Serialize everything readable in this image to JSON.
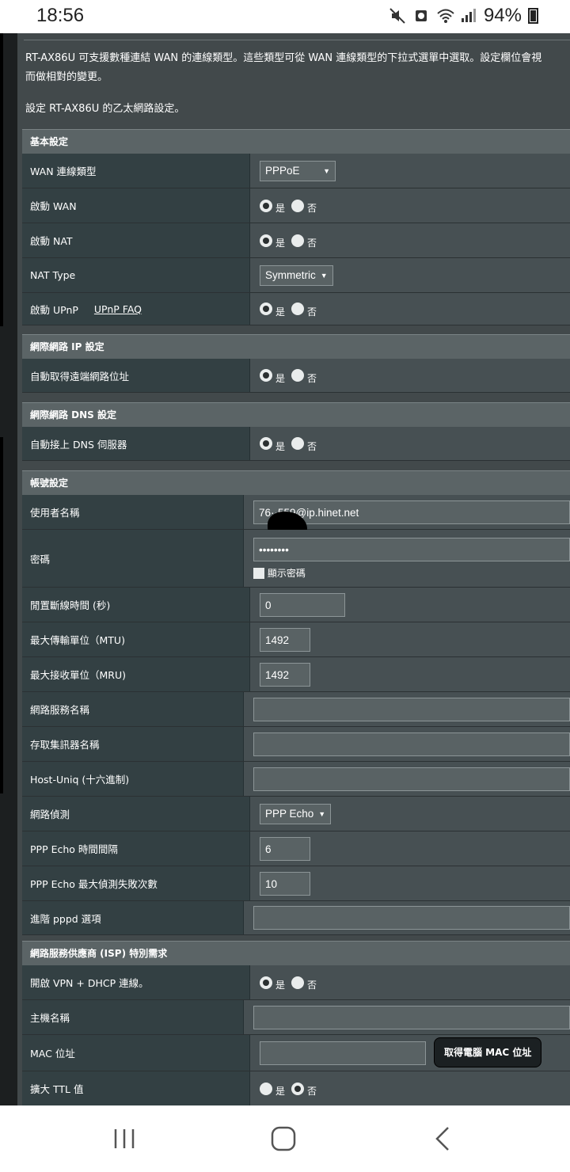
{
  "status": {
    "time": "18:56",
    "battery": "94%",
    "icons": [
      "mute-icon",
      "alarm-icon",
      "wifi-icon",
      "signal-icon",
      "battery-icon"
    ]
  },
  "intro": {
    "line1": "RT-AX86U 可支援數種連結 WAN 的連線類型。這些類型可從 WAN 連線類型的下拉式選單中選取。設定欄位會視",
    "line2": "而做相對的變更。",
    "line3": "設定 RT-AX86U 的乙太網路設定。"
  },
  "common": {
    "yes": "是",
    "no": "否"
  },
  "basic": {
    "title": "基本設定",
    "wan_type_label": "WAN 連線類型",
    "wan_type_value": "PPPoE",
    "enable_wan_label": "啟動 WAN",
    "enable_nat_label": "啟動 NAT",
    "nat_type_label": "NAT Type",
    "nat_type_value": "Symmetric",
    "upnp_label": "啟動 UPnP",
    "upnp_faq": "UPnP FAQ"
  },
  "ip": {
    "title": "網際網路 IP 設定",
    "auto_ip_label": "自動取得遠端網路位址"
  },
  "dns": {
    "title": "網際網路 DNS 設定",
    "auto_dns_label": "自動接上 DNS 伺服器"
  },
  "account": {
    "title": "帳號設定",
    "username_label": "使用者名稱",
    "username_value": "76··559@ip.hinet.net",
    "password_label": "密碼",
    "password_value": "••••••••",
    "show_password": "顯示密碼",
    "idle_label": "閒置斷線時間 (秒)",
    "idle_value": "0",
    "mtu_label": "最大傳輸單位（MTU)",
    "mtu_value": "1492",
    "mru_label": "最大接收單位（MRU)",
    "mru_value": "1492",
    "service_label": "網路服務名稱",
    "concentrator_label": "存取集訊器名稱",
    "hostuniq_label": "Host-Uniq (十六進制)",
    "detect_label": "網路偵測",
    "detect_value": "PPP Echo",
    "echo_interval_label": "PPP Echo 時間間隔",
    "echo_interval_value": "6",
    "echo_fail_label": "PPP Echo 最大偵測失敗次數",
    "echo_fail_value": "10",
    "pppd_label": "進階 pppd 選項"
  },
  "isp": {
    "title": "網路服務供應商 (ISP) 特別需求",
    "vpn_dhcp_label": "開啟 VPN + DHCP 連線。",
    "hostname_label": "主機名稱",
    "mac_label": "MAC 位址",
    "mac_button": "取得電腦 MAC 位址",
    "ttl_label": "擴大 TTL 值"
  },
  "nav": {
    "icons": [
      "recent-apps-icon",
      "home-icon",
      "back-icon"
    ]
  }
}
